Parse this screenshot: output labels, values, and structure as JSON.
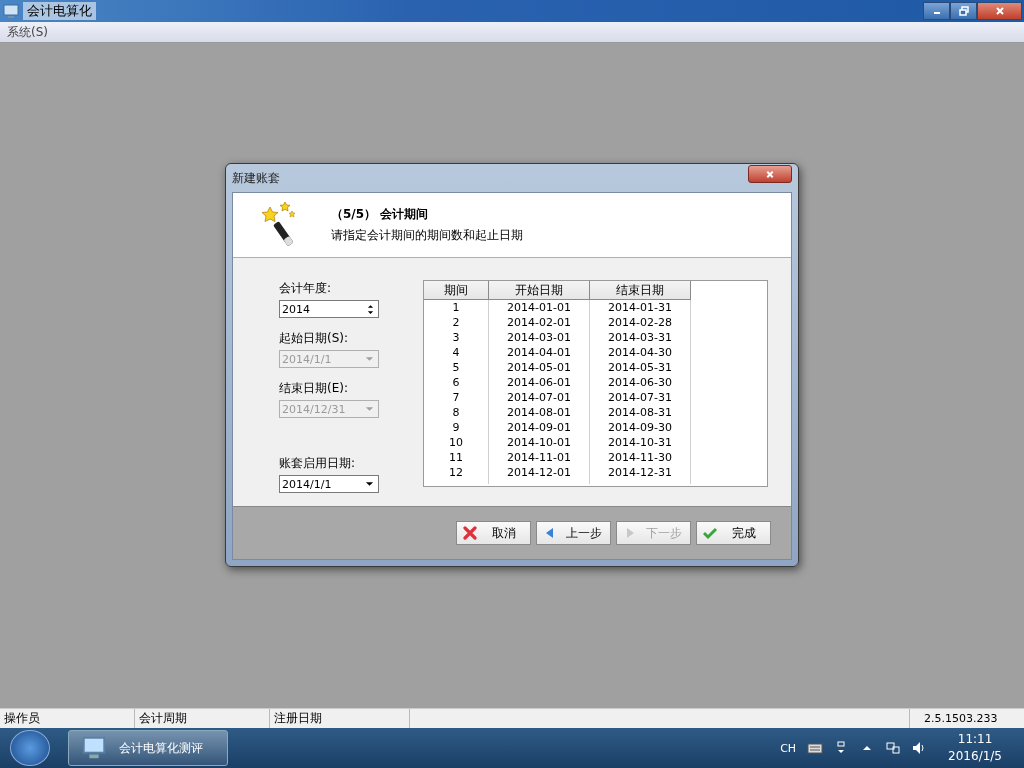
{
  "window": {
    "title": "会计电算化",
    "menu": [
      "系统(S)"
    ]
  },
  "dialog": {
    "title": "新建账套",
    "step": "（5/5） 会计期间",
    "subtitle": "请指定会计期间的期间数和起止日期",
    "fields": [
      {
        "kind": "spin",
        "label": "会计年度:",
        "value": "2014",
        "disabled": false
      },
      {
        "kind": "dropdown",
        "label": "起始日期(S):",
        "value": "2014/1/1",
        "disabled": true
      },
      {
        "kind": "dropdown",
        "label": "结束日期(E):",
        "value": "2014/12/31",
        "disabled": true
      },
      {
        "kind": "dropdown",
        "label": "账套启用日期:",
        "value": "2014/1/1",
        "disabled": false
      }
    ],
    "table": {
      "columns": [
        "期间",
        "开始日期",
        "结束日期"
      ],
      "rows": [
        [
          "1",
          "2014-01-01",
          "2014-01-31"
        ],
        [
          "2",
          "2014-02-01",
          "2014-02-28"
        ],
        [
          "3",
          "2014-03-01",
          "2014-03-31"
        ],
        [
          "4",
          "2014-04-01",
          "2014-04-30"
        ],
        [
          "5",
          "2014-05-01",
          "2014-05-31"
        ],
        [
          "6",
          "2014-06-01",
          "2014-06-30"
        ],
        [
          "7",
          "2014-07-01",
          "2014-07-31"
        ],
        [
          "8",
          "2014-08-01",
          "2014-08-31"
        ],
        [
          "9",
          "2014-09-01",
          "2014-09-30"
        ],
        [
          "10",
          "2014-10-01",
          "2014-10-31"
        ],
        [
          "11",
          "2014-11-01",
          "2014-11-30"
        ],
        [
          "12",
          "2014-12-01",
          "2014-12-31"
        ]
      ]
    },
    "buttons": [
      {
        "kind": "cancel",
        "label": "取消",
        "disabled": false
      },
      {
        "kind": "back",
        "label": "上一步",
        "disabled": false
      },
      {
        "kind": "next",
        "label": "下一步",
        "disabled": true
      },
      {
        "kind": "finish",
        "label": "完成",
        "disabled": false
      }
    ]
  },
  "status_bar": {
    "cells": [
      "操作员",
      "会计周期",
      "注册日期"
    ],
    "version": "2.5.1503.233"
  },
  "taskbar": {
    "app": "会计电算化测评",
    "language": "CH",
    "time": "11:11",
    "date": "2016/1/5"
  }
}
